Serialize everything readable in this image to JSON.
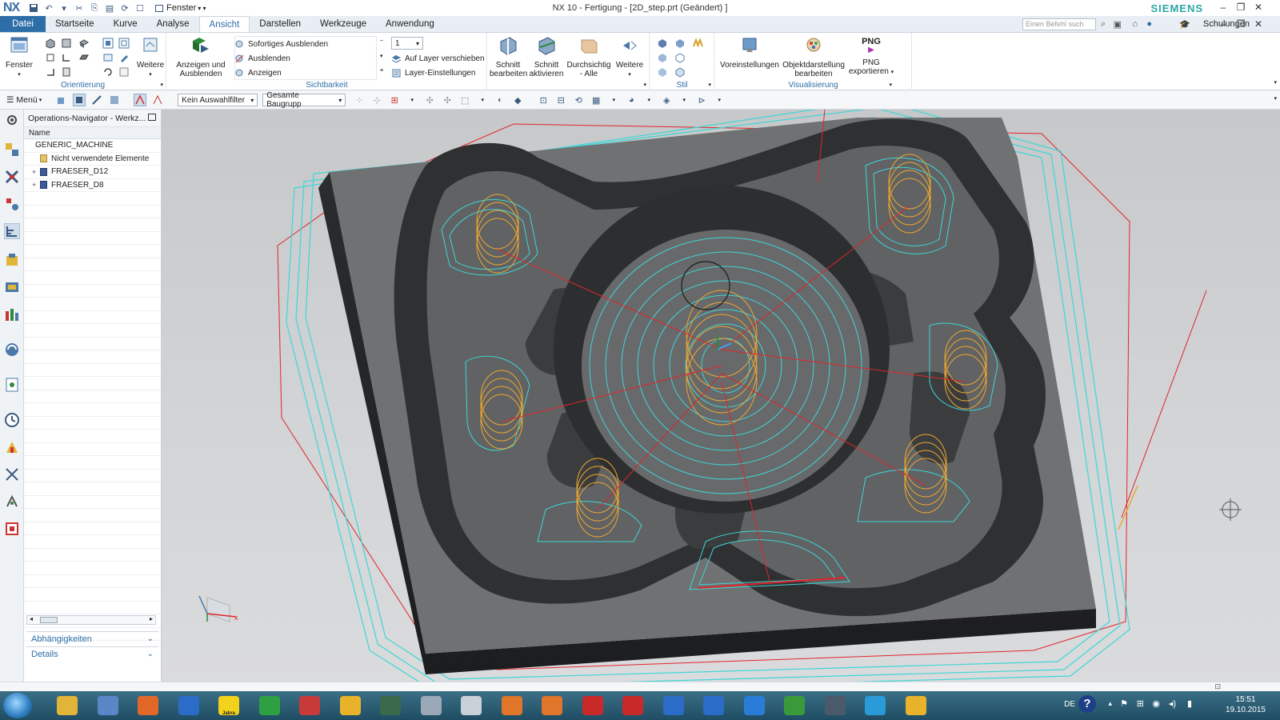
{
  "titlebar": {
    "logo": "NX",
    "window_menu": "Fenster",
    "title": "NX 10 - Fertigung - [2D_step.prt (Geändert) ]",
    "brand": "SIEMENS"
  },
  "menubar": {
    "tabs": [
      "Datei",
      "Startseite",
      "Kurve",
      "Analyse",
      "Ansicht",
      "Darstellen",
      "Werkzeuge",
      "Anwendung"
    ],
    "active_tab": "Ansicht",
    "search_placeholder": "Einen Befehl such",
    "training": "Schulungen"
  },
  "ribbon": {
    "fenster": "Fenster",
    "weitere1": "Weitere",
    "orientierung": "Orientierung",
    "anzeigen_ausblenden": "Anzeigen und Ausblenden",
    "sofortiges": "Sofortiges Ausblenden",
    "ausblenden": "Ausblenden",
    "anzeigen": "Anzeigen",
    "layer_value": "1",
    "auf_layer": "Auf Layer verschieben",
    "layer_einst": "Layer-Einstellungen",
    "sichtbarkeit": "Sichtbarkeit",
    "schnitt_bearbeiten": "Schnitt bearbeiten",
    "schnitt_aktivieren": "Schnitt aktivieren",
    "durchsichtig": "Durchsichtig - Alle",
    "weitere2": "Weitere",
    "stil": "Stil",
    "voreinstellungen": "Voreinstellungen",
    "objektdarstellung": "Objektdarstellung bearbeiten",
    "png_label": "PNG",
    "png_export": "PNG exportieren",
    "visualisierung": "Visualisierung"
  },
  "toolbar2": {
    "menu": "Menü",
    "filter": "Kein Auswahlfilter",
    "assembly": "Gesamte Baugrupp"
  },
  "navigator": {
    "title": "Operations-Navigator - Werkz...",
    "column": "Name",
    "rows": [
      {
        "label": "GENERIC_MACHINE",
        "indent": 0,
        "icon": "none",
        "expander": ""
      },
      {
        "label": "Nicht verwendete Elemente",
        "indent": 1,
        "icon": "folder-icon",
        "expander": ""
      },
      {
        "label": "FRAESER_D12",
        "indent": 1,
        "icon": "tool-icon",
        "expander": "+"
      },
      {
        "label": "FRAESER_D8",
        "indent": 1,
        "icon": "tool-icon",
        "expander": "+"
      }
    ],
    "dependencies": "Abhängigkeiten",
    "details": "Details"
  },
  "taskbar": {
    "apps": [
      "explorer",
      "libreoffice",
      "firefox",
      "outlook",
      "jabra",
      "winword-jr",
      "moodle",
      "sunflower",
      "photo-viewer",
      "snipping",
      "3d-viewer",
      "inventor-1",
      "inventor-pro",
      "solidworks",
      "solidworks-2015",
      "nx-1",
      "nx-2",
      "teamviewer",
      "camtasia",
      "media",
      "skype",
      "sunflower-2"
    ],
    "jabra_label": "Jabra",
    "lang": "DE",
    "time": "15:51",
    "date": "19.10.2015"
  },
  "colors": {
    "accent": "#2d6ea8",
    "toolpath_cyan": "#3fd6d6",
    "toolpath_orange": "#f0a82e",
    "rapid_red": "#e0262b",
    "part_dark": "#333537",
    "floor_gray": "#6f7173"
  }
}
